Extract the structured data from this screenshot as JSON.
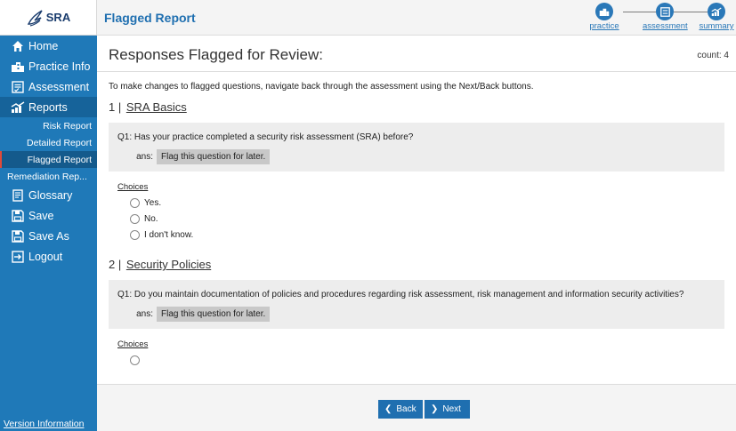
{
  "logo": {
    "text": "SRA"
  },
  "header": {
    "title": "Flagged Report"
  },
  "steps": [
    {
      "label": "practice"
    },
    {
      "label": "assessment"
    },
    {
      "label": "summary"
    }
  ],
  "sidebar": {
    "items": [
      {
        "label": "Home"
      },
      {
        "label": "Practice Info"
      },
      {
        "label": "Assessment"
      },
      {
        "label": "Reports"
      }
    ],
    "sub_items": [
      {
        "label": "Risk Report"
      },
      {
        "label": "Detailed Report"
      },
      {
        "label": "Flagged Report"
      },
      {
        "label": "Remediation Rep..."
      }
    ],
    "bottom_items": [
      {
        "label": "Glossary"
      },
      {
        "label": "Save"
      },
      {
        "label": "Save As"
      },
      {
        "label": "Logout"
      }
    ],
    "version": "Version Information"
  },
  "main": {
    "title": "Responses Flagged for Review:",
    "count": "count: 4",
    "instruction": "To make changes to flagged questions, navigate back through the assessment using the Next/Back buttons.",
    "sections": [
      {
        "number": "1 |",
        "name": "SRA Basics",
        "question": "Q1: Has your practice completed a security risk assessment (SRA) before?",
        "ans_label": "ans:",
        "answer": "Flag this question for later.",
        "choices_label": "Choices",
        "choices": [
          "Yes.",
          "No.",
          "I don't know."
        ]
      },
      {
        "number": "2 |",
        "name": "Security Policies",
        "question": "Q1: Do you maintain documentation of policies and procedures regarding risk assessment, risk management and information security activities?",
        "ans_label": "ans:",
        "answer": "Flag this question for later.",
        "choices_label": "Choices"
      }
    ]
  },
  "footer": {
    "back": "Back",
    "next": "Next"
  },
  "colors": {
    "sidebar": "#1f79b8",
    "accent": "#1f6fb0",
    "flag_marker": "#e04a3a"
  }
}
